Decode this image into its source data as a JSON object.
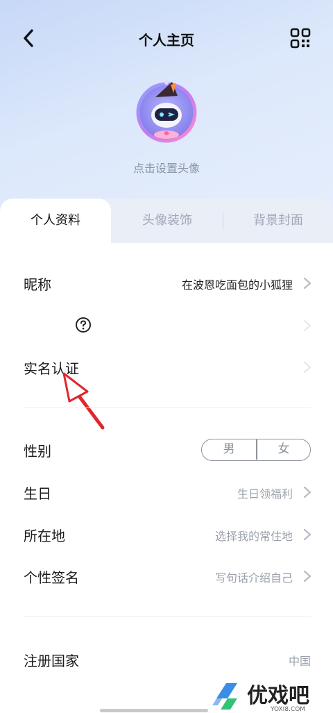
{
  "header": {
    "title": "个人主页",
    "avatar_caption": "点击设置头像"
  },
  "tabs": [
    {
      "label": "个人资料",
      "active": true
    },
    {
      "label": "头像装饰",
      "active": false
    },
    {
      "label": "背景封面",
      "active": false
    }
  ],
  "profile": {
    "nickname": {
      "label": "昵称",
      "value": "在波恩吃面包的小狐狸"
    },
    "realname": {
      "label": "实名认证"
    },
    "gender": {
      "label": "性别",
      "options": [
        "男",
        "女"
      ]
    },
    "birthday": {
      "label": "生日",
      "value": "生日领福利"
    },
    "location": {
      "label": "所在地",
      "value": "选择我的常住地"
    },
    "signature": {
      "label": "个性签名",
      "value": "写句话介绍自己"
    },
    "country": {
      "label": "注册国家",
      "value": "中国"
    }
  },
  "watermark": {
    "brand": "优戏吧",
    "url": "YOXI8.COM"
  },
  "colors": {
    "accent": "#e0262d",
    "muted": "#9aa0ab",
    "header_bg": "#d6e3fa"
  }
}
